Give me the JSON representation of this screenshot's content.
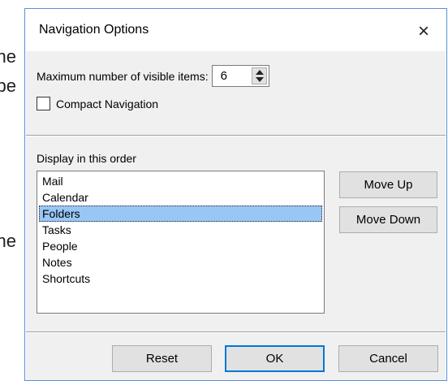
{
  "background_text": {
    "line_1": "the",
    "line_2": "be",
    "line_3": "he"
  },
  "dialog": {
    "title": "Navigation Options",
    "close_glyph": "×",
    "max_visible": {
      "label": "Maximum number of visible items:",
      "value": "6"
    },
    "compact_navigation": {
      "label": "Compact Navigation",
      "checked": false
    },
    "order_label": "Display in this order",
    "items": [
      {
        "label": "Mail",
        "selected": false
      },
      {
        "label": "Calendar",
        "selected": false
      },
      {
        "label": "Folders",
        "selected": true
      },
      {
        "label": "Tasks",
        "selected": false
      },
      {
        "label": "People",
        "selected": false
      },
      {
        "label": "Notes",
        "selected": false
      },
      {
        "label": "Shortcuts",
        "selected": false
      }
    ],
    "buttons": {
      "move_up": "Move Up",
      "move_down": "Move Down",
      "reset": "Reset",
      "ok": "OK",
      "cancel": "Cancel"
    }
  },
  "colors": {
    "dialog_border": "#5a91d8",
    "selection": "#99c7f5",
    "default_button_border": "#0078d7"
  }
}
